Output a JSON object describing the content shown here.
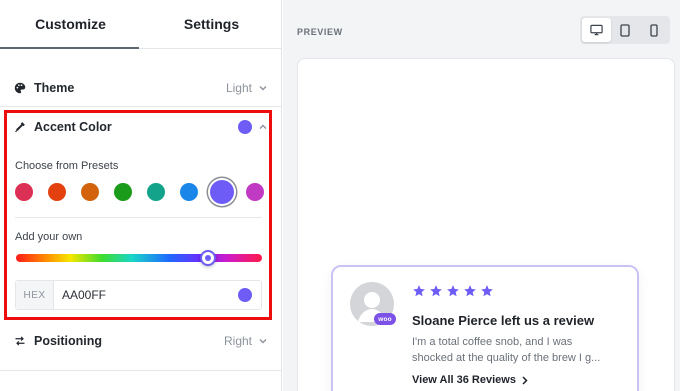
{
  "tabs": [
    {
      "label": "Customize",
      "active": true
    },
    {
      "label": "Settings",
      "active": false
    }
  ],
  "theme": {
    "label": "Theme",
    "value": "Light"
  },
  "accent": {
    "label": "Accent Color",
    "color": "#6d5cf5",
    "presets_label": "Choose from Presets",
    "presets": [
      "#dc2f55",
      "#e2410f",
      "#d2630c",
      "#1a9c1a",
      "#13a38a",
      "#1b86ea",
      "#6d5cf5",
      "#c03ac4"
    ],
    "selected_preset_index": 6,
    "custom_label": "Add your own",
    "hex_label": "HEX",
    "hex_value": "AA00FF",
    "hue_position": 0.78
  },
  "positioning": {
    "label": "Positioning",
    "value": "Right"
  },
  "preview": {
    "label": "PREVIEW",
    "devices": [
      {
        "name": "desktop",
        "active": true
      },
      {
        "name": "tablet",
        "active": false
      },
      {
        "name": "mobile",
        "active": false
      }
    ],
    "card": {
      "badge": "woo",
      "stars": 5,
      "title": "Sloane Pierce left us a review",
      "body_line1": "I'm a total coffee snob, and I was",
      "body_line2": "shocked at the quality of the brew I g...",
      "link": "View All 36 Reviews",
      "star_color": "#6d5cf5"
    }
  }
}
